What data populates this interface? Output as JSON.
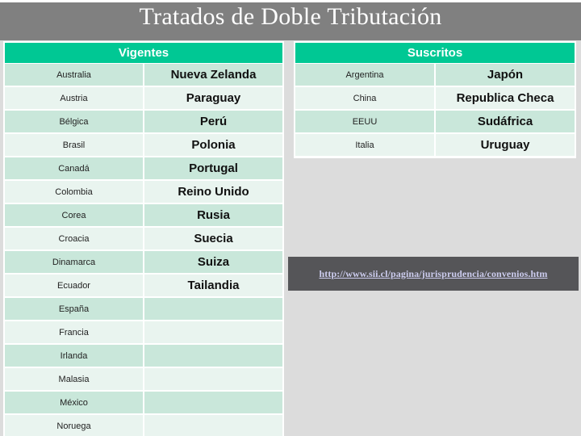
{
  "slide": {
    "title": "Tratados de Doble Tributación",
    "background_color": "#dcdcdc",
    "title_bar_color": "#808080",
    "accent_color": "#00c894",
    "row_dark_color": "#c9e7da",
    "row_light_color": "#e9f4ef"
  },
  "tables": {
    "vigentes": {
      "header": "Vigentes",
      "rows": [
        {
          "left": "Australia",
          "right": "Nueva Zelanda"
        },
        {
          "left": "Austria",
          "right": "Paraguay"
        },
        {
          "left": "Bélgica",
          "right": "Perú"
        },
        {
          "left": "Brasil",
          "right": "Polonia"
        },
        {
          "left": "Canadá",
          "right": "Portugal"
        },
        {
          "left": "Colombia",
          "right": "Reino Unido"
        },
        {
          "left": "Corea",
          "right": "Rusia"
        },
        {
          "left": "Croacia",
          "right": "Suecia"
        },
        {
          "left": "Dinamarca",
          "right": "Suiza"
        },
        {
          "left": "Ecuador",
          "right": "Tailandia"
        },
        {
          "left": "España",
          "right": ""
        },
        {
          "left": "Francia",
          "right": ""
        },
        {
          "left": "Irlanda",
          "right": ""
        },
        {
          "left": "Malasia",
          "right": ""
        },
        {
          "left": "México",
          "right": ""
        },
        {
          "left": "Noruega",
          "right": ""
        }
      ]
    },
    "suscritos": {
      "header": "Suscritos",
      "rows": [
        {
          "left": "Argentina",
          "right": "Japón"
        },
        {
          "left": "China",
          "right": "Republica Checa"
        },
        {
          "left": "EEUU",
          "right": "Sudáfrica"
        },
        {
          "left": "Italia",
          "right": "Uruguay"
        }
      ]
    }
  },
  "link": {
    "url_text": "http://www.sii.cl/pagina/jurisprudencia/convenios.htm",
    "box_color": "#555558",
    "text_color": "#ccccee"
  }
}
